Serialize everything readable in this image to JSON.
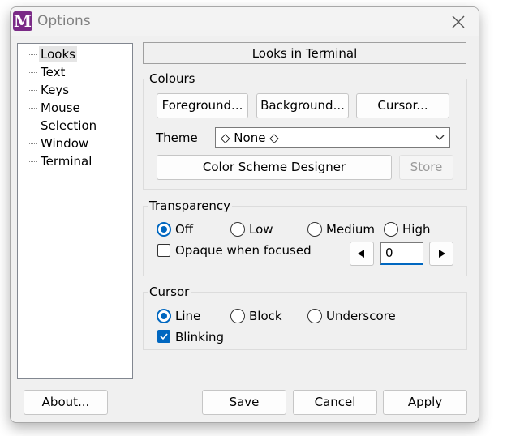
{
  "window": {
    "title": "Options",
    "icon_letter": "M",
    "icon_color": "#7a2a86",
    "close_icon": "close-icon"
  },
  "tree": {
    "items": [
      {
        "label": "Looks",
        "selected": true
      },
      {
        "label": "Text"
      },
      {
        "label": "Keys"
      },
      {
        "label": "Mouse"
      },
      {
        "label": "Selection"
      },
      {
        "label": "Window"
      },
      {
        "label": "Terminal"
      }
    ]
  },
  "panel": {
    "header": "Looks in Terminal"
  },
  "colours": {
    "title": "Colours",
    "foreground_label": "Foreground...",
    "background_label": "Background...",
    "cursor_label": "Cursor...",
    "theme_label": "Theme",
    "theme_value": "◇ None ◇",
    "designer_label": "Color Scheme Designer",
    "store_label": "Store",
    "store_enabled": false
  },
  "transparency": {
    "title": "Transparency",
    "options": [
      "Off",
      "Low",
      "Medium",
      "High"
    ],
    "selected": "Off",
    "opaque_label": "Opaque when focused",
    "opaque_checked": false,
    "value": "0",
    "decrement_icon": "triangle-left-icon",
    "increment_icon": "triangle-right-icon"
  },
  "cursor": {
    "title": "Cursor",
    "options": [
      "Line",
      "Block",
      "Underscore"
    ],
    "selected": "Line",
    "blinking_label": "Blinking",
    "blinking_checked": true
  },
  "footer": {
    "about_label": "About...",
    "save_label": "Save",
    "cancel_label": "Cancel",
    "apply_label": "Apply"
  },
  "accent_color": "#0067c0"
}
